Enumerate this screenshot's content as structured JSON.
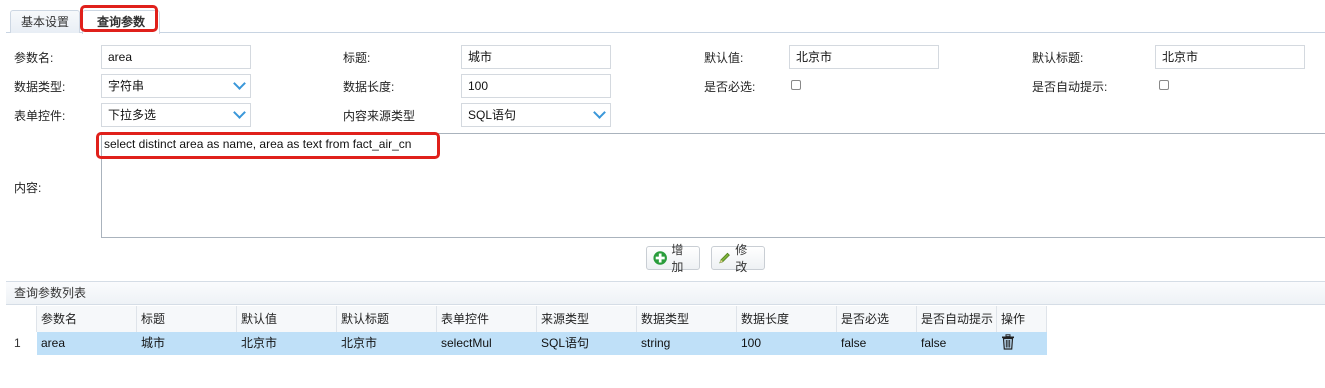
{
  "tabs": [
    {
      "label": "基本设置"
    },
    {
      "label": "查询参数"
    }
  ],
  "form": {
    "param_name_label": "参数名:",
    "param_name_value": "area",
    "title_label": "标题:",
    "title_value": "城市",
    "default_value_label": "默认值:",
    "default_value_value": "北京市",
    "default_title_label": "默认标题:",
    "default_title_value": "北京市",
    "data_type_label": "数据类型:",
    "data_type_value": "字符串",
    "data_length_label": "数据长度:",
    "data_length_value": "100",
    "required_label": "是否必选:",
    "auto_hint_label": "是否自动提示:",
    "form_control_label": "表单控件:",
    "form_control_value": "下拉多选",
    "content_source_label": "内容来源类型",
    "content_source_value": "SQL语句",
    "content_label": "内容:",
    "content_value": "select distinct area as name, area as text from fact_air_cn"
  },
  "buttons": {
    "add": "增加",
    "edit": "修改"
  },
  "list": {
    "title": "查询参数列表",
    "columns": [
      "参数名",
      "标题",
      "默认值",
      "默认标题",
      "表单控件",
      "来源类型",
      "数据类型",
      "数据长度",
      "是否必选",
      "是否自动提示",
      "操作"
    ],
    "rows": [
      {
        "num": "1",
        "cells": [
          "area",
          "城市",
          "北京市",
          "北京市",
          "selectMul",
          "SQL语句",
          "string",
          "100",
          "false",
          "false"
        ]
      }
    ]
  },
  "colors": {
    "highlight": "#e0201b",
    "row_selected": "#bfe0f8",
    "accent": "#3a97d9"
  }
}
